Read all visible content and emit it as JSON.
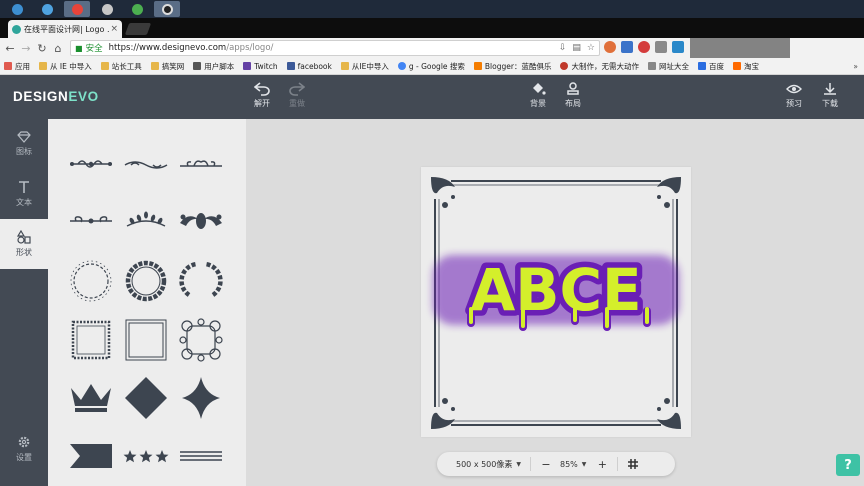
{
  "browser": {
    "tab_title": "在线平面设计网| Logo ...",
    "tab_close": "×",
    "secure_label": "安全",
    "url_main": "https://www.designevo.com",
    "url_path": "/apps/logo/"
  },
  "bookmarks": [
    {
      "label": "应用"
    },
    {
      "label": "从 IE 中导入"
    },
    {
      "label": "站长工具"
    },
    {
      "label": "搞笑网"
    },
    {
      "label": "用户脚本"
    },
    {
      "label": "Twitch"
    },
    {
      "label": "facebook"
    },
    {
      "label": "从IE中导入"
    },
    {
      "label": "g - Google 搜索"
    },
    {
      "label": "Blogger：蓝酷俱乐"
    },
    {
      "label": "大制作，无需大动作"
    },
    {
      "label": "网址大全"
    },
    {
      "label": "百度"
    },
    {
      "label": "淘宝"
    }
  ],
  "bookmarks_more": "»",
  "app": {
    "logo_design": "DESIGN",
    "logo_evo": "EVO",
    "toolbar": {
      "open": "解开",
      "redo": "重做",
      "background": "背景",
      "layout": "布局",
      "preview": "预习",
      "download": "下载"
    },
    "sidebar": {
      "icons": "图标",
      "text": "文本",
      "shapes": "形状",
      "settings": "设置"
    }
  },
  "canvas": {
    "logo_text": "ABCE",
    "size_label": "500 x 500像素",
    "zoom": "85%",
    "zoom_minus": "−",
    "zoom_plus": "+"
  },
  "help_label": "?",
  "colors": {
    "app_dark": "#434a54",
    "brand_accent": "#7ee2c9",
    "logo_fill": "#d4ef2b",
    "logo_outline": "#6a1fb5",
    "help_button": "#3ec2a5",
    "shape_color": "#3d4550"
  }
}
